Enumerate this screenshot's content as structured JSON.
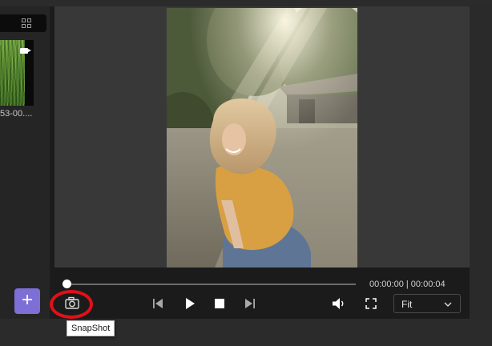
{
  "media": {
    "view_toggle_icon": "grid-icon",
    "clip_label": "53-00....",
    "clip_type_icon": "video-camera-icon",
    "add_label": "+"
  },
  "player": {
    "progress": 0.0,
    "time_readout": "00:00:00 | 00:00:04",
    "icons": {
      "snapshot": "camera-icon",
      "previous": "skip-previous-icon",
      "play": "play-icon",
      "stop": "stop-icon",
      "next": "skip-next-icon",
      "volume": "volume-icon",
      "fullscreen": "fullscreen-icon"
    },
    "fit_select": {
      "value": "Fit"
    }
  },
  "tooltip": {
    "text": "SnapShot"
  },
  "colors": {
    "accent": "#7d6fd6",
    "highlight": "#e0101a",
    "panel": "#383838",
    "controls_bg": "#1b1b1b"
  }
}
